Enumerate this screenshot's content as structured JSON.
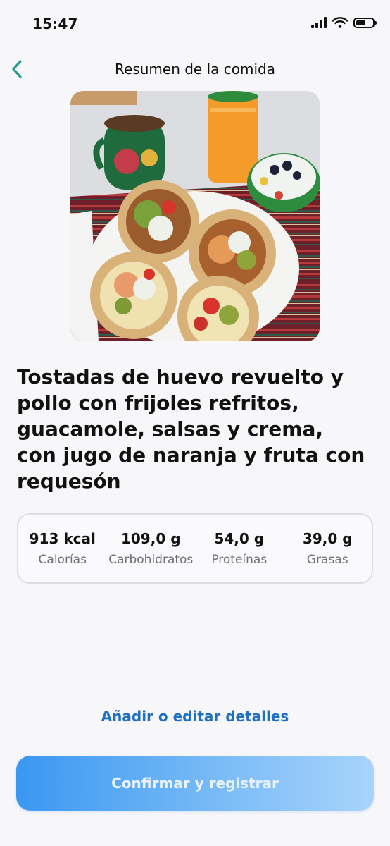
{
  "status_bar": {
    "time": "15:47",
    "icons": [
      "signal-icon",
      "wifi-icon",
      "battery-icon"
    ],
    "battery_level": 0.6
  },
  "nav": {
    "title": "Resumen de la comida",
    "back_icon": "chevron-left-icon"
  },
  "meal": {
    "title": "Tostadas de huevo revuelto y pollo con frijoles refritos, guacamole, salsas y crema, con jugo de naranja y fruta con requesón"
  },
  "nutrition": [
    {
      "value": "913 kcal",
      "label": "Calorías"
    },
    {
      "value": "109,0 g",
      "label": "Carbohidratos"
    },
    {
      "value": "54,0 g",
      "label": "Proteínas"
    },
    {
      "value": "39,0 g",
      "label": "Grasas"
    }
  ],
  "actions": {
    "edit_link": "Añadir o editar detalles",
    "confirm_button": "Confirmar y registrar"
  },
  "colors": {
    "accent": "#1f6fc2",
    "back_icon": "#2a9d8f",
    "button_gradient_start": "#3a97f2",
    "button_gradient_end": "#a8d3fb"
  }
}
